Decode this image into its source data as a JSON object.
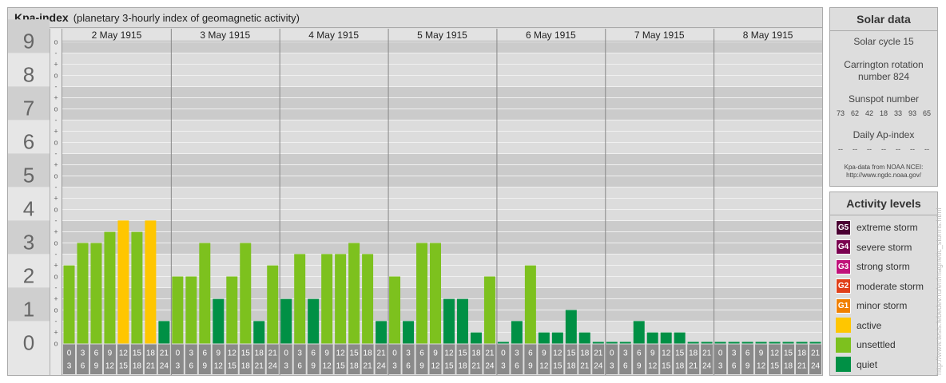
{
  "main_title": "Kpa-index",
  "main_subtitle": "(planetary 3-hourly index of geomagnetic activity)",
  "chart_data": {
    "type": "bar",
    "title": "Kpa-index",
    "subtitle": "(planetary 3-hourly index of geomagnetic activity)",
    "days": [
      "2 May 1915",
      "3 May 1915",
      "4 May 1915",
      "5 May 1915",
      "6 May 1915",
      "7 May 1915",
      "8 May 1915"
    ],
    "interval_start_hours": [
      "0",
      "3",
      "6",
      "9",
      "12",
      "15",
      "18",
      "21"
    ],
    "interval_end_hours": [
      "3",
      "6",
      "9",
      "12",
      "15",
      "18",
      "21",
      "24"
    ],
    "y_ticks": [
      "0",
      "1",
      "2",
      "3",
      "4",
      "5",
      "6",
      "7",
      "8",
      "9"
    ],
    "y_sublabels": [
      "-",
      "o",
      "+"
    ],
    "ylim": [
      0,
      9.33
    ],
    "values": [
      [
        2.33,
        3.0,
        3.0,
        3.33,
        3.67,
        3.33,
        3.67,
        0.67
      ],
      [
        2.0,
        2.0,
        3.0,
        1.33,
        2.0,
        3.0,
        0.67,
        2.33
      ],
      [
        1.33,
        2.67,
        1.33,
        2.67,
        2.67,
        3.0,
        2.67,
        0.67
      ],
      [
        2.0,
        0.67,
        3.0,
        3.0,
        1.33,
        1.33,
        0.33,
        2.0
      ],
      [
        0.0,
        0.67,
        2.33,
        0.33,
        0.33,
        1.0,
        0.33,
        0.0
      ],
      [
        0.0,
        0.0,
        0.67,
        0.33,
        0.33,
        0.33,
        0.0,
        0.0
      ],
      [
        0.0,
        0.0,
        0.0,
        0.0,
        0.0,
        0.0,
        0.0,
        0.0
      ]
    ],
    "bar_colors": {
      "quiet": "#009045",
      "unsettled": "#7dc11e",
      "active": "#ffc600"
    },
    "grid": true
  },
  "solar": {
    "title": "Solar data",
    "cycle": "Solar cycle 15",
    "carrington_line1": "Carrington rotation",
    "carrington_line2": "number 824",
    "sunspot_title": "Sunspot number",
    "sunspots": [
      "73",
      "62",
      "42",
      "18",
      "33",
      "93",
      "65"
    ],
    "ap_title": "Daily Ap-index",
    "ap_values": [
      "--",
      "--",
      "--",
      "--",
      "--",
      "--",
      "--"
    ],
    "source_line1": "Kpa-data from NOAA NCEI:",
    "source_line2": "http://www.ngdc.noaa.gov/"
  },
  "levels": {
    "title": "Activity levels",
    "items": [
      {
        "badge": "G5",
        "label": "extreme storm",
        "color": "#4a0033"
      },
      {
        "badge": "G4",
        "label": "severe storm",
        "color": "#7a0050"
      },
      {
        "badge": "G3",
        "label": "strong storm",
        "color": "#c0127a"
      },
      {
        "badge": "G2",
        "label": "moderate storm",
        "color": "#e0401a"
      },
      {
        "badge": "G1",
        "label": "minor storm",
        "color": "#f08000"
      },
      {
        "badge": "",
        "label": "active",
        "color": "#ffc600"
      },
      {
        "badge": "",
        "label": "unsettled",
        "color": "#7dc11e"
      },
      {
        "badge": "",
        "label": "quiet",
        "color": "#009045"
      }
    ]
  },
  "watermark": "http://www.tesis.lebedev.ru/en/magnetic_storms.html"
}
